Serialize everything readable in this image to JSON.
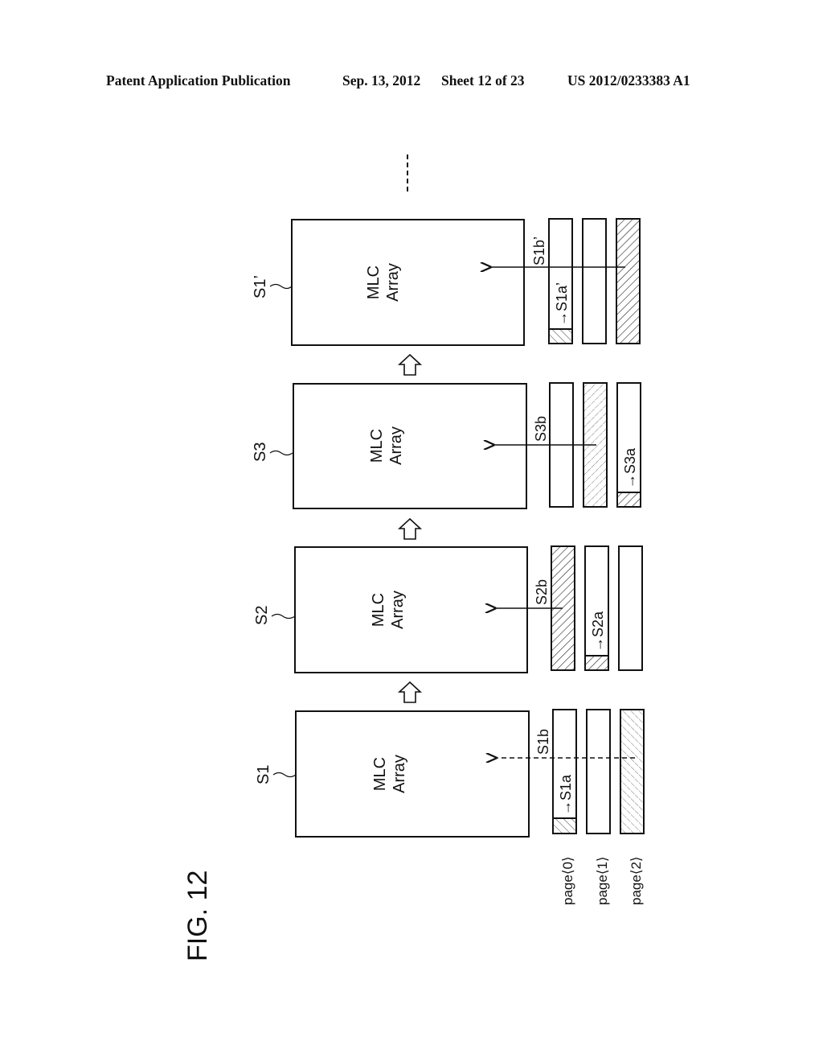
{
  "header": {
    "publication_type": "Patent Application Publication",
    "date": "Sep. 13, 2012",
    "sheet": "Sheet 12 of 23",
    "number": "US 2012/0233383 A1"
  },
  "figure": {
    "title": "FIG. 12",
    "continuation_mark": "----",
    "page_labels": [
      "page⟨0⟩",
      "page⟨1⟩",
      "page⟨2⟩"
    ],
    "states": [
      {
        "id": "S1",
        "label": "S1",
        "array_label_line1": "MLC",
        "array_label_line2": "Array",
        "pages": [
          {
            "fill": "partial-hatched",
            "note": "→S1a"
          },
          {
            "fill": "empty",
            "note": ""
          },
          {
            "fill": "hatched-light",
            "note": ""
          }
        ],
        "transfer_label": "S1b",
        "transfer_style": "dashed",
        "transfer_source_page": 2
      },
      {
        "id": "S2",
        "label": "S2",
        "array_label_line1": "MLC",
        "array_label_line2": "Array",
        "pages": [
          {
            "fill": "hatched",
            "note": ""
          },
          {
            "fill": "partial-hatched",
            "note": "→S2a"
          },
          {
            "fill": "empty",
            "note": ""
          }
        ],
        "transfer_label": "S2b",
        "transfer_style": "solid",
        "transfer_source_page": 0
      },
      {
        "id": "S3",
        "label": "S3",
        "array_label_line1": "MLC",
        "array_label_line2": "Array",
        "pages": [
          {
            "fill": "empty",
            "note": ""
          },
          {
            "fill": "hatched-light",
            "note": ""
          },
          {
            "fill": "partial-hatched",
            "note": "→S3a"
          }
        ],
        "transfer_label": "S3b",
        "transfer_style": "solid",
        "transfer_source_page": 1
      },
      {
        "id": "S1prime",
        "label": "S1’",
        "array_label_line1": "MLC",
        "array_label_line2": "Array",
        "pages": [
          {
            "fill": "partial-hatched",
            "note": "→S1a’"
          },
          {
            "fill": "empty",
            "note": ""
          },
          {
            "fill": "hatched",
            "note": ""
          }
        ],
        "transfer_label": "S1b’",
        "transfer_style": "solid",
        "transfer_source_page": 2
      }
    ]
  }
}
